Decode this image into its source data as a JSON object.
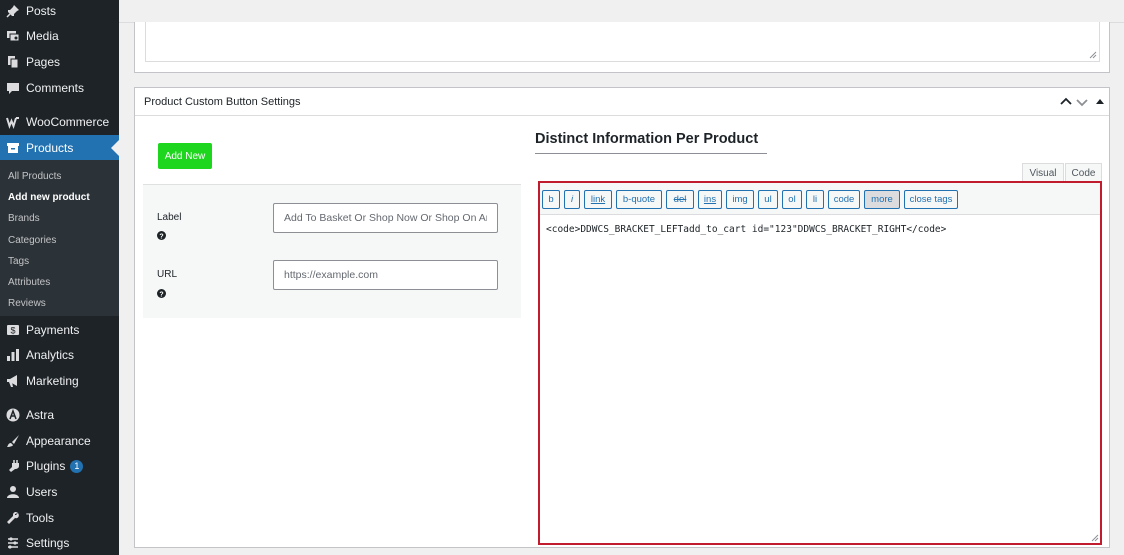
{
  "sidebar": {
    "items": [
      {
        "key": "posts",
        "label": "Posts",
        "icon": "pin-icon"
      },
      {
        "key": "media",
        "label": "Media",
        "icon": "media-icon"
      },
      {
        "key": "pages",
        "label": "Pages",
        "icon": "pages-icon"
      },
      {
        "key": "comments",
        "label": "Comments",
        "icon": "comment-icon"
      },
      {
        "key": "woocommerce",
        "label": "WooCommerce",
        "icon": "woocommerce-icon"
      },
      {
        "key": "products",
        "label": "Products",
        "icon": "archive-icon"
      },
      {
        "key": "payments",
        "label": "Payments",
        "icon": "payments-icon"
      },
      {
        "key": "analytics",
        "label": "Analytics",
        "icon": "bar-chart-icon"
      },
      {
        "key": "marketing",
        "label": "Marketing",
        "icon": "megaphone-icon"
      },
      {
        "key": "astra",
        "label": "Astra",
        "icon": "astra-icon"
      },
      {
        "key": "appearance",
        "label": "Appearance",
        "icon": "brush-icon"
      },
      {
        "key": "plugins",
        "label": "Plugins",
        "icon": "plug-icon",
        "badge": "1"
      },
      {
        "key": "users",
        "label": "Users",
        "icon": "user-icon"
      },
      {
        "key": "tools",
        "label": "Tools",
        "icon": "wrench-icon"
      },
      {
        "key": "settings",
        "label": "Settings",
        "icon": "settings-icon"
      }
    ],
    "products_submenu": [
      "All Products",
      "Add new product",
      "Brands",
      "Categories",
      "Tags",
      "Attributes",
      "Reviews"
    ]
  },
  "panel": {
    "title": "Product Custom Button Settings",
    "add_new_label": "Add New",
    "label_field": {
      "label": "Label",
      "placeholder": "Add To Basket Or Shop Now Or Shop On Amazon"
    },
    "url_field": {
      "label": "URL",
      "placeholder": "https://example.com"
    },
    "section_title": "Distinct Information Per Product",
    "tabs": {
      "visual": "Visual",
      "code": "Code"
    },
    "toolbar": [
      "b",
      "i",
      "link",
      "b-quote",
      "del",
      "ins",
      "img",
      "ul",
      "ol",
      "li",
      "code",
      "more",
      "close tags"
    ],
    "editor_content": "<code>DDWCS_BRACKET_LEFTadd_to_cart id=\"123\"DDWCS_BRACKET_RIGHT</code>"
  },
  "colors": {
    "sidebar_bg": "#1d2327",
    "active_menu": "#2271b1",
    "add_new_button": "#1ed61e",
    "editor_border": "#c01c2e"
  }
}
